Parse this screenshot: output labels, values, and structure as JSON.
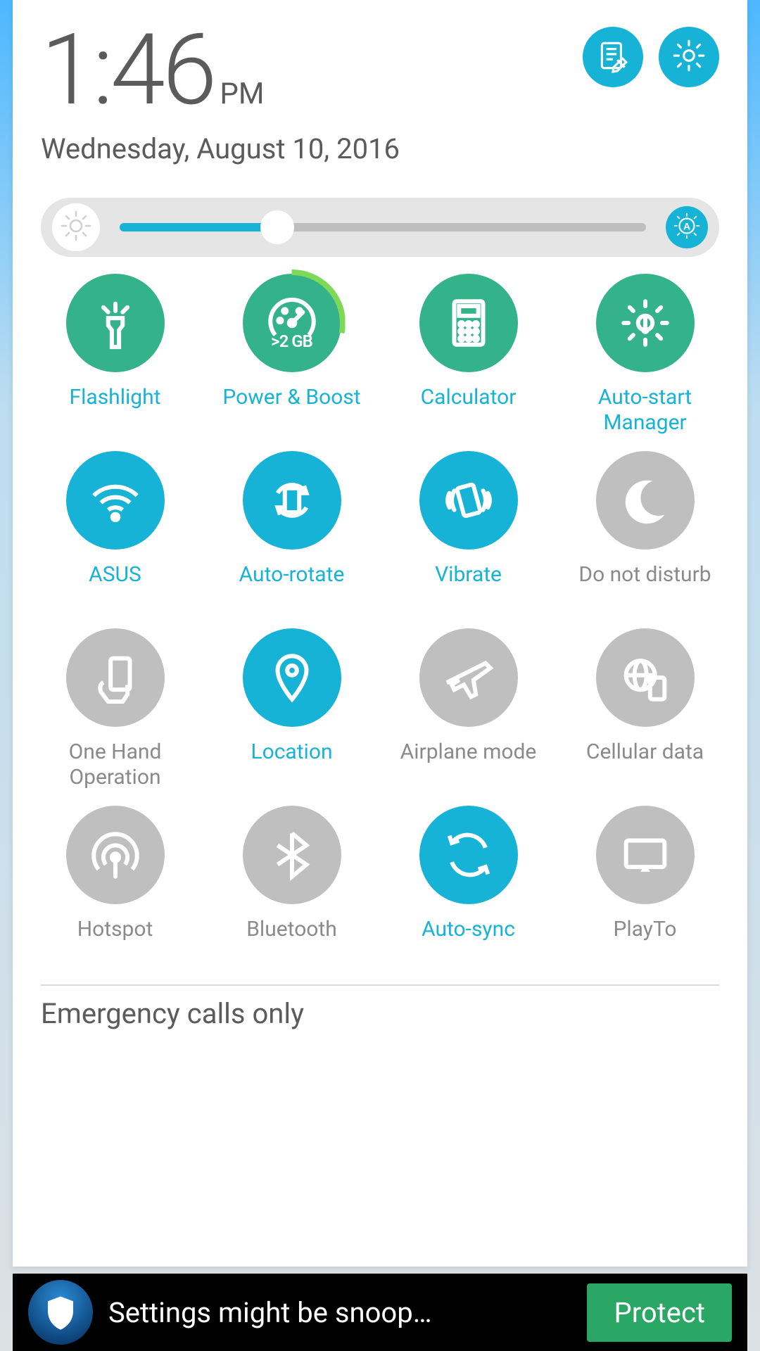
{
  "header": {
    "time": "1:46",
    "meridiem": "PM",
    "date": "Wednesday, August 10, 2016"
  },
  "brightness": {
    "percent": 30,
    "auto": true
  },
  "toggles": [
    {
      "id": "flashlight",
      "label": "Flashlight",
      "state": "green",
      "icon": "flashlight"
    },
    {
      "id": "powerboost",
      "label": "Power & Boost",
      "state": "green",
      "icon": "boost",
      "boost_text": ">2 GB"
    },
    {
      "id": "calculator",
      "label": "Calculator",
      "state": "green",
      "icon": "calculator"
    },
    {
      "id": "autostart",
      "label": "Auto-start\nManager",
      "state": "green",
      "icon": "gear-warn"
    },
    {
      "id": "wifi",
      "label": "ASUS",
      "state": "blue",
      "icon": "wifi"
    },
    {
      "id": "autorotate",
      "label": "Auto-rotate",
      "state": "blue",
      "icon": "rotate"
    },
    {
      "id": "vibrate",
      "label": "Vibrate",
      "state": "blue",
      "icon": "vibrate"
    },
    {
      "id": "dnd",
      "label": "Do not disturb",
      "state": "grey",
      "icon": "moon"
    },
    {
      "id": "onehand",
      "label": "One Hand\nOperation",
      "state": "grey",
      "icon": "onehand"
    },
    {
      "id": "location",
      "label": "Location",
      "state": "blue",
      "icon": "pin"
    },
    {
      "id": "airplane",
      "label": "Airplane mode",
      "state": "grey",
      "icon": "airplane"
    },
    {
      "id": "cellular",
      "label": "Cellular data",
      "state": "grey",
      "icon": "globe-device"
    },
    {
      "id": "hotspot",
      "label": "Hotspot",
      "state": "grey",
      "icon": "hotspot"
    },
    {
      "id": "bluetooth",
      "label": "Bluetooth",
      "state": "grey",
      "icon": "bluetooth"
    },
    {
      "id": "autosync",
      "label": "Auto-sync",
      "state": "blue",
      "icon": "sync"
    },
    {
      "id": "playto",
      "label": "PlayTo",
      "state": "grey",
      "icon": "cast"
    }
  ],
  "status_line": "Emergency calls only",
  "notification": {
    "title": "Settings might be snoop…",
    "button": "Protect"
  }
}
